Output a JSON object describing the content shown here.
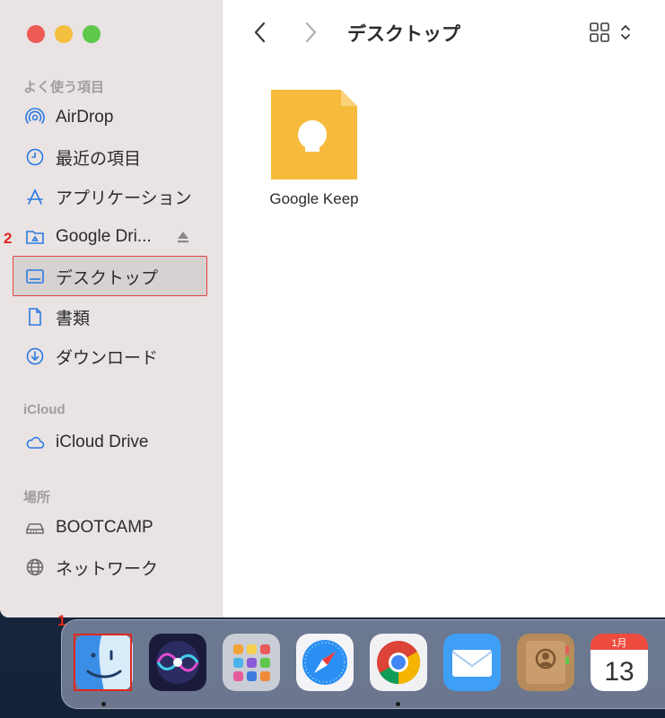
{
  "window": {
    "title": "デスクトップ",
    "traffic_lights": [
      "close",
      "minimize",
      "zoom"
    ]
  },
  "toolbar": {
    "back_icon": "chevron-left-icon",
    "forward_icon": "chevron-right-icon",
    "view_icon": "grid-view-icon"
  },
  "sidebar": {
    "favorites_title": "よく使う項目",
    "favorites": [
      {
        "label": "AirDrop",
        "icon": "airdrop-icon"
      },
      {
        "label": "最近の項目",
        "icon": "clock-icon"
      },
      {
        "label": "アプリケーション",
        "icon": "applications-icon"
      },
      {
        "label": "Google Dri...",
        "icon": "folder-icon"
      },
      {
        "label": "デスクトップ",
        "icon": "desktop-icon",
        "selected": true
      },
      {
        "label": "書類",
        "icon": "document-icon"
      },
      {
        "label": "ダウンロード",
        "icon": "download-icon"
      }
    ],
    "icloud_title": "iCloud",
    "icloud": [
      {
        "label": "iCloud Drive",
        "icon": "cloud-icon"
      }
    ],
    "locations_title": "場所",
    "locations": [
      {
        "label": "BOOTCAMP",
        "icon": "disk-icon"
      },
      {
        "label": "ネットワーク",
        "icon": "globe-icon"
      }
    ]
  },
  "content": {
    "files": [
      {
        "name": "Google Keep",
        "icon": "google-keep-icon"
      }
    ]
  },
  "annotations": {
    "step1": "1",
    "step2": "2"
  },
  "dock": {
    "apps": [
      {
        "name": "Finder",
        "icon": "finder-icon",
        "running": true
      },
      {
        "name": "Siri",
        "icon": "siri-icon",
        "running": false
      },
      {
        "name": "Launchpad",
        "icon": "launchpad-icon",
        "running": false
      },
      {
        "name": "Safari",
        "icon": "safari-icon",
        "running": false
      },
      {
        "name": "Chrome",
        "icon": "chrome-icon",
        "running": true
      },
      {
        "name": "Mail",
        "icon": "mail-icon",
        "running": false
      },
      {
        "name": "Contacts",
        "icon": "contacts-icon",
        "running": false
      },
      {
        "name": "Calendar",
        "icon": "calendar-icon",
        "running": false
      }
    ],
    "calendar_month": "1月",
    "calendar_day": "13"
  },
  "colors": {
    "accent": "#2a79e0",
    "annotation": "#e0261f",
    "sidebar_bg": "#e9e3e4",
    "keep_yellow": "#f6bb3c"
  }
}
